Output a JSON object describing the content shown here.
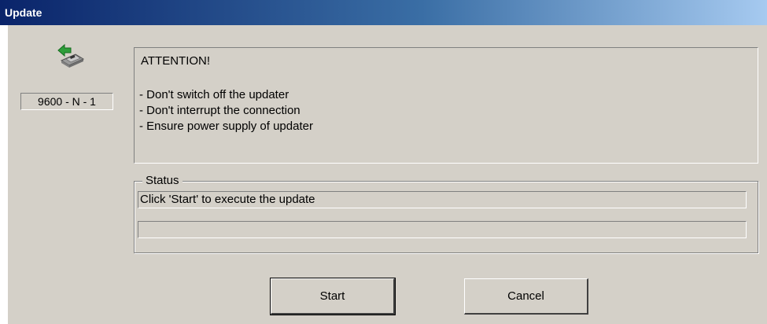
{
  "window": {
    "title": "Update"
  },
  "device": {
    "icon": "device-update-icon",
    "port_settings": "9600 - N - 1"
  },
  "attention": {
    "heading": "ATTENTION!",
    "items": [
      "- Don't switch off the updater",
      "- Don't interrupt the connection",
      "- Ensure power supply of updater"
    ]
  },
  "status": {
    "label": "Status",
    "message": "Click 'Start' to execute the update",
    "progress": 0
  },
  "buttons": {
    "start_label": "Start",
    "cancel_label": "Cancel"
  },
  "colors": {
    "titlebar_start": "#0a246a",
    "titlebar_end": "#a6caf0",
    "face": "#d4d0c8"
  }
}
